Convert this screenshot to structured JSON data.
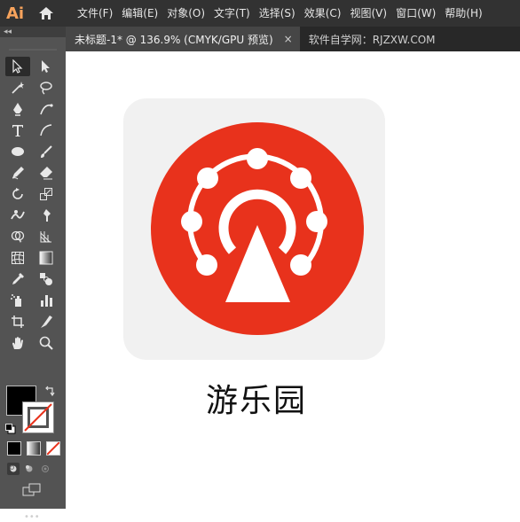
{
  "app": {
    "logo_text": "Ai",
    "accent": "#f7a35c"
  },
  "menu": [
    "文件(F)",
    "编辑(E)",
    "对象(O)",
    "文字(T)",
    "选择(S)",
    "效果(C)",
    "视图(V)",
    "窗口(W)",
    "帮助(H)"
  ],
  "tabs": {
    "active": "未标题-1* @ 136.9% (CMYK/GPU 预览)",
    "close": "×",
    "inactive": "软件自学网：RJZXW.COM"
  },
  "toolbar": {
    "collapse_label": "◂◂",
    "more_label": "•••"
  },
  "canvas": {
    "app_name": "游乐园",
    "colors": {
      "tile": "#f1f1f1",
      "circle": "#e8321c",
      "glyph": "#ffffff"
    }
  }
}
